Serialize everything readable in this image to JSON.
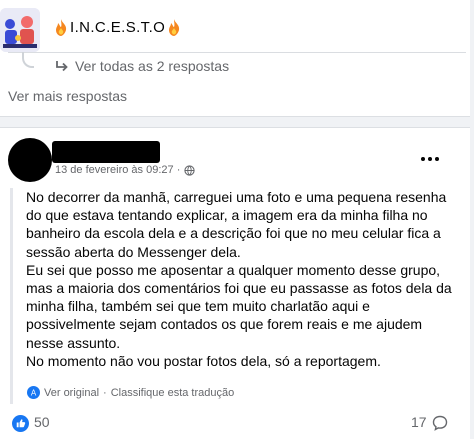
{
  "group": {
    "name": "I.N.C.E.S.T.O"
  },
  "replies": {
    "see_all": "Ver todas as 2 respostas",
    "see_more": "Ver mais respostas"
  },
  "post": {
    "timestamp": "13 de fevereiro às 09:27 ·",
    "paragraphs": [
      "No decorrer da manhã, carreguei uma foto e uma pequena resenha do que estava tentando explicar, a imagem era da minha filha no banheiro da escola dela e a descrição foi que no meu celular fica a sessão aberta do Messenger dela.",
      "Eu sei que posso me aposentar a qualquer momento desse grupo, mas a maioria dos comentários foi que eu passasse as fotos dela da minha filha, também sei que tem muito charlatão aqui e possivelmente sejam contados os que forem reais e me ajudem nesse assunto.",
      "No momento não vou postar fotos dela, só a reportagem."
    ],
    "see_original": "Ver original",
    "separator": "·",
    "rate_translation": "Classifique esta tradução",
    "like_count": "50",
    "comment_count": "17"
  },
  "colors": {
    "accent": "#1877f2",
    "secondary_text": "#65676b",
    "fire": "#f5871f"
  },
  "icons": [
    "fire-icon",
    "reply-arrow-icon",
    "globe-icon",
    "more-icon",
    "translate-icon",
    "like-icon",
    "comment-icon"
  ]
}
